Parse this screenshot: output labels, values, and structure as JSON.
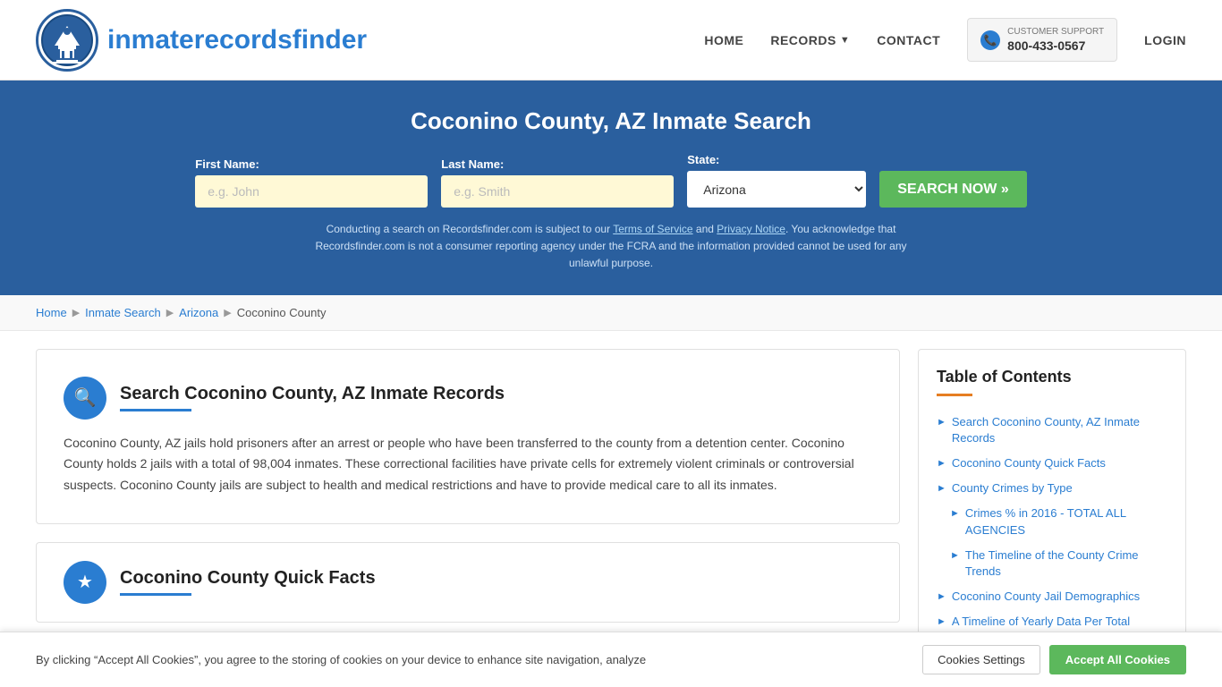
{
  "header": {
    "logo_text_plain": "inmaterecords",
    "logo_text_bold": "finder",
    "nav": {
      "home": "HOME",
      "records": "RECORDS",
      "contact": "CONTACT",
      "login": "LOGIN"
    },
    "support": {
      "label": "CUSTOMER SUPPORT",
      "phone": "800-433-0567"
    }
  },
  "hero": {
    "title": "Coconino County, AZ Inmate Search",
    "first_name_label": "First Name:",
    "first_name_placeholder": "e.g. John",
    "last_name_label": "Last Name:",
    "last_name_placeholder": "e.g. Smith",
    "state_label": "State:",
    "state_value": "Arizona",
    "search_btn": "SEARCH NOW »",
    "disclaimer": "Conducting a search on Recordsfinder.com is subject to our Terms of Service and Privacy Notice. You acknowledge that Recordsfinder.com is not a consumer reporting agency under the FCRA and the information provided cannot be used for any unlawful purpose."
  },
  "breadcrumb": {
    "home": "Home",
    "inmate_search": "Inmate Search",
    "arizona": "Arizona",
    "coconino_county": "Coconino County"
  },
  "content": {
    "card1": {
      "title": "Search Coconino County, AZ Inmate Records",
      "body": "Coconino County, AZ jails hold prisoners after an arrest or people who have been transferred to the county from a detention center. Coconino County holds 2 jails with a total of 98,004 inmates. These correctional facilities have private cells for extremely violent criminals or controversial suspects. Coconino County jails are subject to health and medical restrictions and have to provide medical care to all its inmates."
    }
  },
  "toc": {
    "title": "Table of Contents",
    "items": [
      {
        "label": "Search Coconino County, AZ Inmate Records",
        "sub": false
      },
      {
        "label": "Coconino County Quick Facts",
        "sub": false
      },
      {
        "label": "County Crimes by Type",
        "sub": false
      },
      {
        "label": "Crimes % in 2016 - TOTAL ALL AGENCIES",
        "sub": true
      },
      {
        "label": "The Timeline of the County Crime Trends",
        "sub": true
      },
      {
        "label": "Coconino County Jail Demographics",
        "sub": false
      },
      {
        "label": "A Timeline of Yearly Data Per Total",
        "sub": false
      }
    ]
  },
  "cookie_banner": {
    "text": "By clicking “Accept All Cookies”, you agree to the storing of cookies on your device to enhance site navigation, analyze",
    "settings_btn": "Cookies Settings",
    "accept_btn": "Accept All Cookies"
  }
}
